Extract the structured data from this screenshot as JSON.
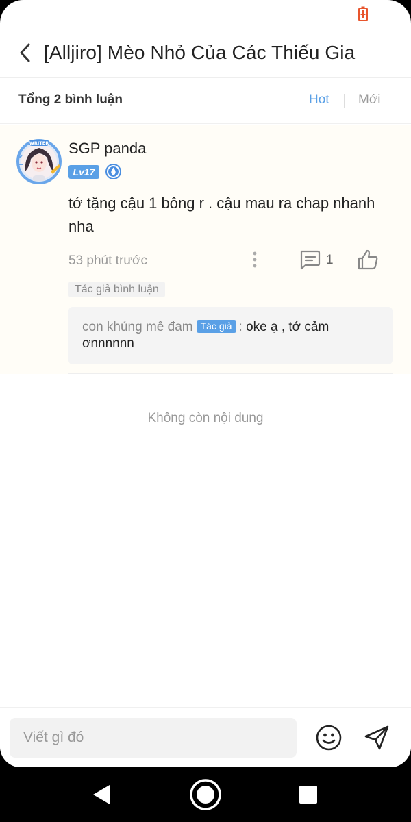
{
  "app_bar": {
    "title": "[Alljiro] Mèo Nhỏ Của Các Thiếu Gia"
  },
  "sort_bar": {
    "total_label": "Tổng 2 bình luận",
    "hot_label": "Hot",
    "new_label": "Mới",
    "active_color": "#5aa0e6"
  },
  "comment": {
    "username": "SGP panda",
    "level": "Lv17",
    "text": "tớ tặng cậu 1 bông r . cậu mau ra chap nhanh nha",
    "time": "53 phút trước",
    "reply_count": "1",
    "author_comment_tag": "Tác giả bình luận",
    "avatar_icon": "writer-avatar-icon",
    "reply": {
      "author": "con khủng mê đam",
      "author_tag": "Tác giả",
      "separator": ":",
      "text": "oke ạ , tớ cảm ơnnnnnn"
    }
  },
  "list_end_text": "Không còn nội dung",
  "composer": {
    "placeholder": "Viết gì đó"
  },
  "colors": {
    "accent": "#5aa0e6",
    "battery": "#e8552d"
  }
}
